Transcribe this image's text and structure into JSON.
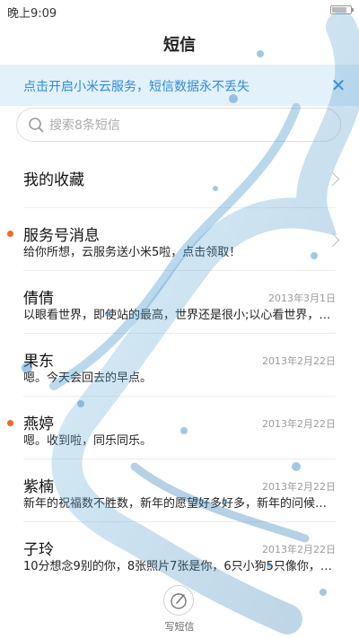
{
  "status_bar": {
    "time": "晚上9:09",
    "battery_level": 0.8
  },
  "header": {
    "title": "短信"
  },
  "banner": {
    "text": "点击开启小米云服务，短信数据永不丢失",
    "close_icon": "close-icon"
  },
  "search": {
    "placeholder": "搜索8条短信",
    "value": ""
  },
  "list": {
    "favorites": {
      "label": "我的收藏"
    },
    "service": {
      "title": "服务号消息",
      "preview": "给你所想，云服务送小米5啦，点击领取！"
    },
    "conversations": [
      {
        "name": "倩倩",
        "date": "2013年3月1日",
        "preview": "以眼看世界，即使站的最高，世界还是很小;以心看世界，…",
        "unread": false
      },
      {
        "name": "果东",
        "date": "2013年2月22日",
        "preview": "嗯。今天会回去的早点。",
        "unread": false
      },
      {
        "name": "燕婷",
        "date": "2013年2月22日",
        "preview": "嗯。收到啦，同乐同乐。",
        "unread": true
      },
      {
        "name": "紫楠",
        "date": "2013年2月22日",
        "preview": "新年的祝福数不胜数，新年的愿望好多好多，新年的问候…",
        "unread": false
      },
      {
        "name": "子玲",
        "date": "2013年2月22日",
        "preview": "10分想念9别的你，8张照片7张是你，6只小狗5只像你，4…",
        "unread": false
      }
    ]
  },
  "compose": {
    "label": "写短信",
    "icon": "compose-icon"
  },
  "colors": {
    "accent": "#2e8bd8",
    "banner_bg": "#e3f1fb",
    "unread": "#f06a23"
  }
}
